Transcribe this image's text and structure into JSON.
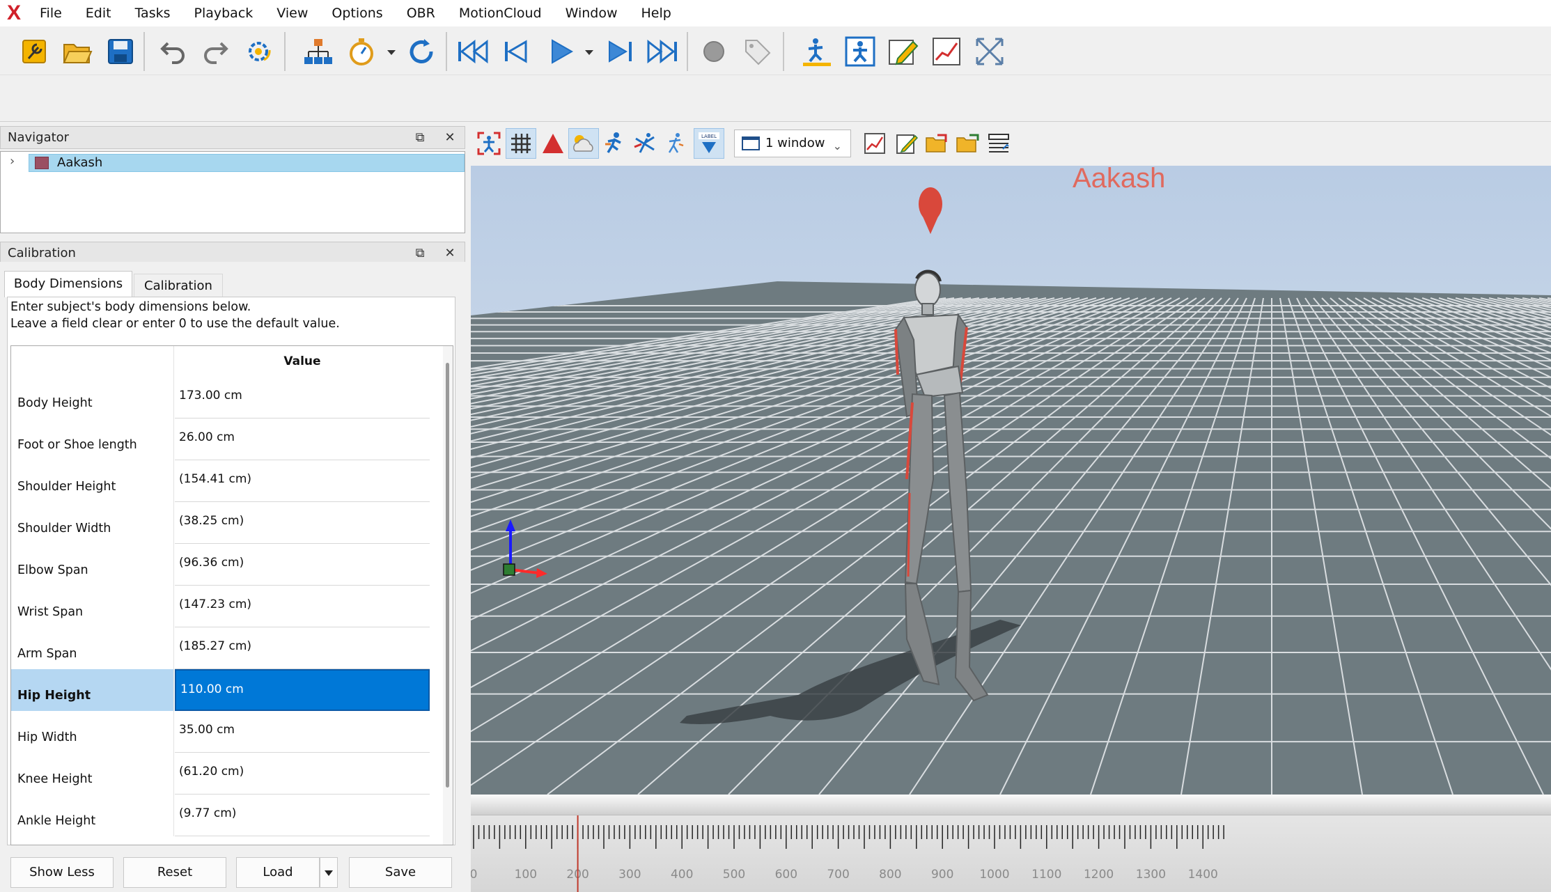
{
  "app": {
    "logo_letter": "X"
  },
  "menu": [
    "File",
    "Edit",
    "Tasks",
    "Playback",
    "View",
    "Options",
    "OBR",
    "MotionCloud",
    "Window",
    "Help"
  ],
  "toolbar_icons": [
    "wrench-icon",
    "open-folder-icon",
    "save-icon",
    "undo-icon",
    "redo-icon",
    "settings-sync-icon",
    "hierarchy-icon",
    "stopwatch-icon",
    "refresh-icon",
    "skip-to-start-icon",
    "previous-frame-icon",
    "play-icon",
    "next-frame-icon",
    "skip-to-end-icon",
    "record-icon",
    "tag-icon",
    "calibration-figure-icon",
    "motion-figure-icon",
    "edit-pencil-icon",
    "graph-icon",
    "fullscreen-icon"
  ],
  "navigator": {
    "title": "Navigator",
    "items": [
      {
        "label": "Aakash",
        "color": "#9a4f62"
      }
    ]
  },
  "calibration": {
    "title": "Calibration",
    "tabs": [
      "Body Dimensions",
      "Calibration"
    ],
    "instruction_line1": "Enter subject's body dimensions below.",
    "instruction_line2": "Leave a field clear or enter 0 to use the default value.",
    "value_header": "Value",
    "rows": [
      {
        "name": "Body Height",
        "value": "173.00 cm"
      },
      {
        "name": "Foot or Shoe length",
        "value": "26.00 cm"
      },
      {
        "name": "Shoulder Height",
        "value": "(154.41 cm)"
      },
      {
        "name": "Shoulder Width",
        "value": "(38.25 cm)"
      },
      {
        "name": "Elbow Span",
        "value": "(96.36 cm)"
      },
      {
        "name": "Wrist Span",
        "value": "(147.23 cm)"
      },
      {
        "name": "Arm Span",
        "value": "(185.27 cm)"
      },
      {
        "name": "Hip Height",
        "value": "110.00 cm",
        "selected": true
      },
      {
        "name": "Hip Width",
        "value": "35.00 cm"
      },
      {
        "name": "Knee Height",
        "value": "(61.20 cm)"
      },
      {
        "name": "Ankle Height",
        "value": "(9.77 cm)"
      }
    ],
    "buttons": {
      "show_less": "Show Less",
      "reset": "Reset",
      "load": "Load",
      "save": "Save"
    }
  },
  "viewer": {
    "window_select": "1 window",
    "subject_label": "Aakash",
    "timeline_labels": [
      "0",
      "100",
      "200",
      "300",
      "400",
      "500",
      "600",
      "700",
      "800",
      "900",
      "1000",
      "1100",
      "1200",
      "1300",
      "1400"
    ],
    "playhead_frame": 200
  },
  "colors": {
    "selection": "#0078d7",
    "subject_label": "#e06a5e",
    "accent_red": "#d0202a"
  }
}
